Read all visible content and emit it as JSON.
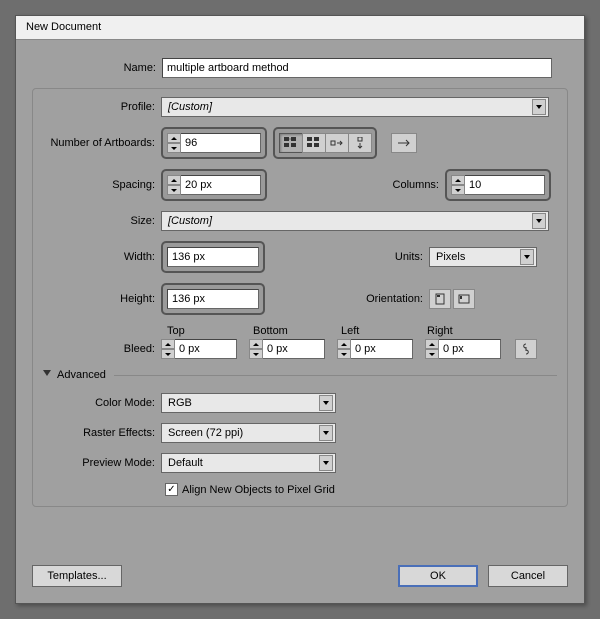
{
  "dialog": {
    "title": "New Document"
  },
  "form": {
    "name_label": "Name:",
    "name_value": "multiple artboard method",
    "profile_label": "Profile:",
    "profile_value": "[Custom]",
    "artboards_label": "Number of Artboards:",
    "artboards_value": "96",
    "spacing_label": "Spacing:",
    "spacing_value": "20 px",
    "columns_label": "Columns:",
    "columns_value": "10",
    "size_label": "Size:",
    "size_value": "[Custom]",
    "width_label": "Width:",
    "width_value": "136 px",
    "height_label": "Height:",
    "height_value": "136 px",
    "units_label": "Units:",
    "units_value": "Pixels",
    "orientation_label": "Orientation:",
    "bleed_label": "Bleed:",
    "bleed_top": "Top",
    "bleed_bottom": "Bottom",
    "bleed_left": "Left",
    "bleed_right": "Right",
    "bleed_value": "0 px"
  },
  "advanced": {
    "header": "Advanced",
    "color_mode_label": "Color Mode:",
    "color_mode_value": "RGB",
    "raster_label": "Raster Effects:",
    "raster_value": "Screen (72 ppi)",
    "preview_label": "Preview Mode:",
    "preview_value": "Default",
    "align_pixel_grid": "Align New Objects to Pixel Grid"
  },
  "buttons": {
    "templates": "Templates...",
    "ok": "OK",
    "cancel": "Cancel"
  }
}
